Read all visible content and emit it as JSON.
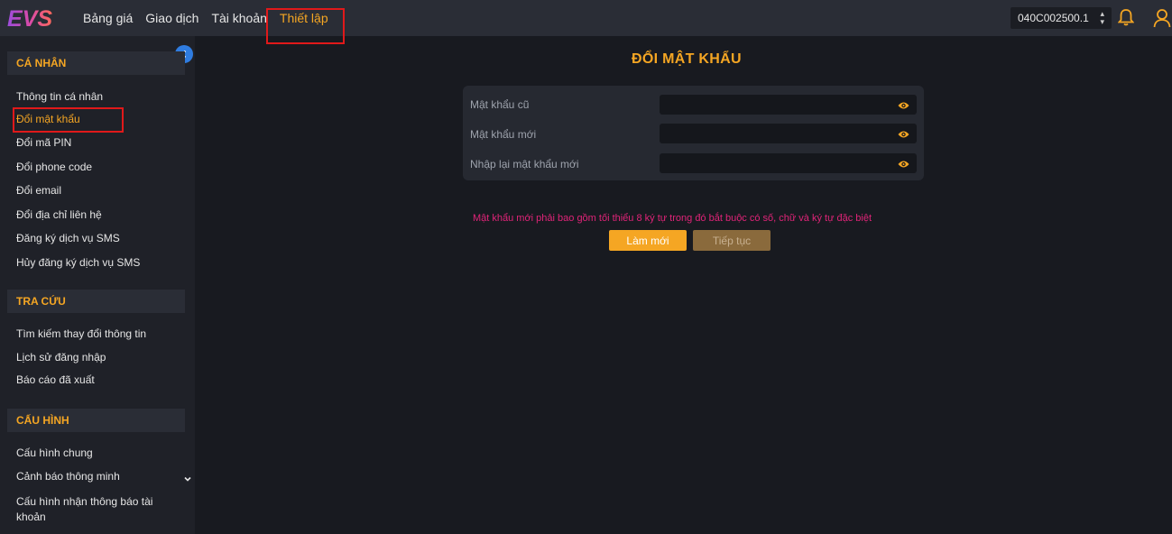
{
  "topbar": {
    "logo_text": "EVS",
    "nav": [
      {
        "label": "Bảng giá"
      },
      {
        "label": "Giao dịch"
      },
      {
        "label": "Tài khoản"
      },
      {
        "label": "Thiết lập",
        "active": true
      }
    ],
    "account": "040C002500.1"
  },
  "sidebar": {
    "sections": [
      {
        "title": "CÁ NHÂN",
        "items": [
          {
            "label": "Thông tin cá nhân"
          },
          {
            "label": "Đổi mật khẩu",
            "active": true
          },
          {
            "label": "Đổi mã PIN"
          },
          {
            "label": "Đổi phone code"
          },
          {
            "label": "Đổi email"
          },
          {
            "label": "Đổi địa chỉ liên hệ"
          },
          {
            "label": "Đăng ký dịch vụ SMS"
          },
          {
            "label": "Hủy đăng ký dịch vụ SMS"
          }
        ]
      },
      {
        "title": "TRA CỨU",
        "items": [
          {
            "label": "Tìm kiếm thay đổi thông tin"
          },
          {
            "label": "Lịch sử đăng nhập"
          },
          {
            "label": "Báo cáo đã xuất"
          }
        ]
      },
      {
        "title": "CẤU HÌNH",
        "items": [
          {
            "label": "Cấu hình chung"
          },
          {
            "label": "Cảnh báo thông minh"
          },
          {
            "label": "Cấu hình nhận thông báo tài"
          },
          {
            "label": "khoản"
          }
        ]
      }
    ]
  },
  "main": {
    "title": "ĐỔI MẬT KHẨU",
    "fields": [
      {
        "label": "Mật khẩu cũ",
        "value": ""
      },
      {
        "label": "Mật khẩu mới",
        "value": ""
      },
      {
        "label": "Nhập lại mật khẩu mới",
        "value": ""
      }
    ],
    "note": "Mật khẩu mới phải bao gồm tối thiểu 8 ký tự trong đó bắt buộc có số, chữ và ký tự đặc biệt",
    "reset_label": "Làm mới",
    "next_label": "Tiếp tục"
  },
  "colors": {
    "accent": "#f5a623",
    "note": "#e02478",
    "highlight": "#e0191a",
    "collapse": "#2f7ce0"
  }
}
